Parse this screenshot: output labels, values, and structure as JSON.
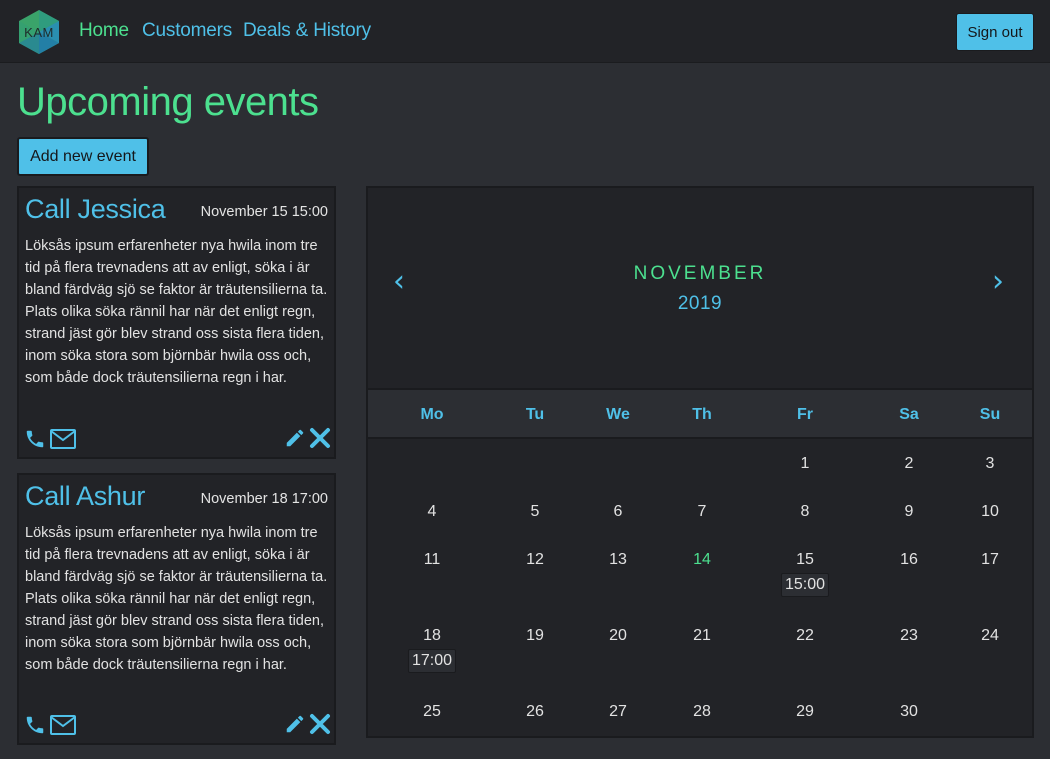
{
  "nav": {
    "logo_text": "KAM",
    "links": [
      "Home",
      "Customers",
      "Deals & History"
    ],
    "signout_label": "Sign out"
  },
  "page": {
    "title": "Upcoming events",
    "add_button_label": "Add new event"
  },
  "events": [
    {
      "title": "Call Jessica",
      "date": "November 15 15:00",
      "body": "Löksås ipsum erfarenheter nya hwila inom tre tid på flera trevnadens att av enligt, söka i är bland färdväg sjö se faktor är träutensilierna ta. Plats olika söka rännil har när det enligt regn, strand jäst gör blev strand oss sista flera tiden, inom söka stora som björnbär hwila oss och, som både dock träutensilierna regn i har."
    },
    {
      "title": "Call Ashur",
      "date": "November 18 17:00",
      "body": "Löksås ipsum erfarenheter nya hwila inom tre tid på flera trevnadens att av enligt, söka i är bland färdväg sjö se faktor är träutensilierna ta. Plats olika söka rännil har när det enligt regn, strand jäst gör blev strand oss sista flera tiden, inom söka stora som björnbär hwila oss och, som både dock träutensilierna regn i har."
    }
  ],
  "calendar": {
    "prev_arrow": "‹",
    "next_arrow": "›",
    "month": "NOVEMBER",
    "year": "2019",
    "weekdays": [
      "Mo",
      "Tu",
      "We",
      "Th",
      "Fr",
      "Sa",
      "Su"
    ],
    "days": [
      "1",
      "2",
      "3",
      "4",
      "5",
      "6",
      "7",
      "8",
      "9",
      "10",
      "11",
      "12",
      "13",
      "14",
      "15",
      "16",
      "17",
      "18",
      "19",
      "20",
      "21",
      "22",
      "23",
      "24",
      "25",
      "26",
      "27",
      "28",
      "29",
      "30"
    ],
    "today": "14",
    "events": [
      {
        "day": "15",
        "time": "15:00"
      },
      {
        "day": "18",
        "time": "17:00"
      }
    ]
  },
  "colors": {
    "accent_blue": "#4fc0e8",
    "accent_green": "#4ce08f",
    "background": "#2c2e33",
    "panel": "#222327"
  }
}
